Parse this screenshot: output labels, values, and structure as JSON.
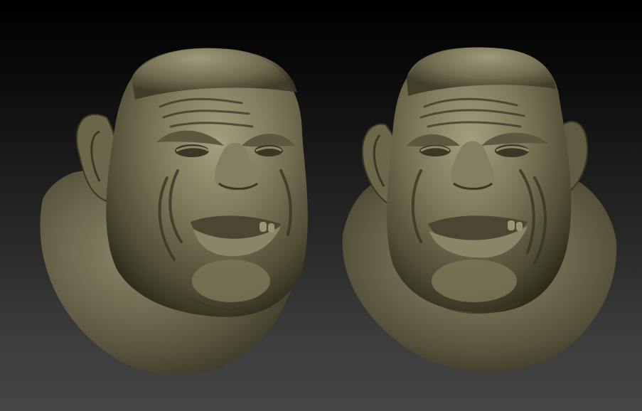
{
  "scene": {
    "type": "sculpt-render",
    "background": {
      "top_color": "#000000",
      "bottom_color": "#454545"
    },
    "material": {
      "base_color": "#6f6a50",
      "highlight_color": "#a7a184",
      "shadow_color": "#2a2818"
    },
    "views": [
      {
        "name": "three-quarter-left",
        "facing": "right"
      },
      {
        "name": "three-quarter-right",
        "facing": "left"
      }
    ]
  }
}
